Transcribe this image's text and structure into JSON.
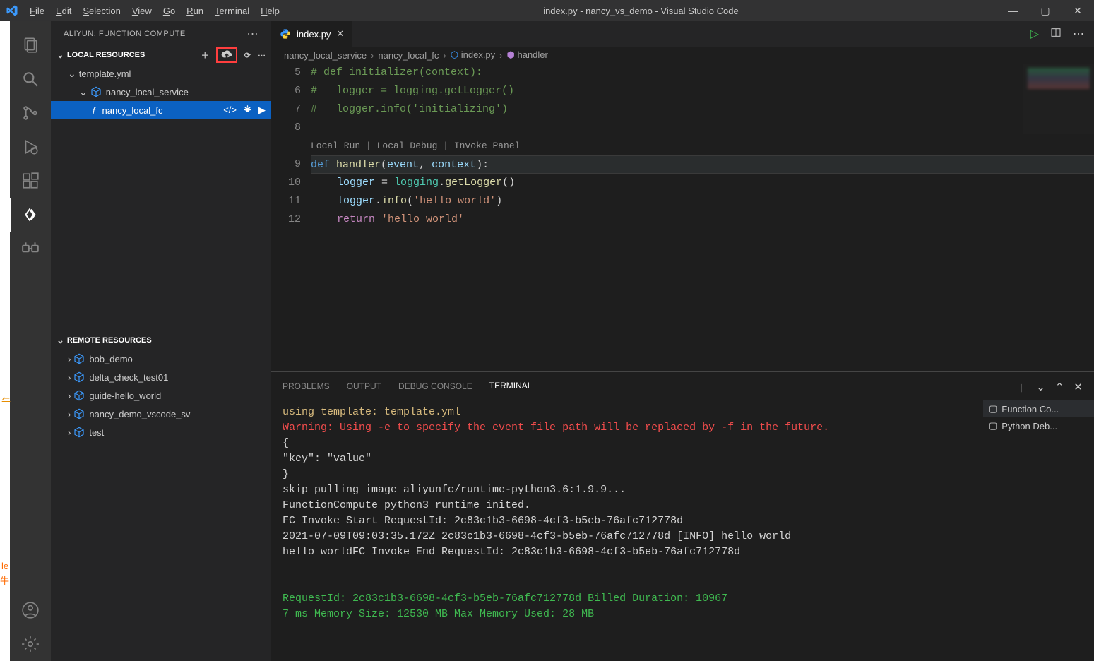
{
  "window": {
    "title": "index.py - nancy_vs_demo - Visual Studio Code",
    "menu": [
      "File",
      "Edit",
      "Selection",
      "View",
      "Go",
      "Run",
      "Terminal",
      "Help"
    ],
    "menu_underline_idx": [
      0,
      0,
      0,
      0,
      0,
      0,
      0,
      0
    ]
  },
  "sidebar": {
    "title": "ALIYUN: FUNCTION COMPUTE",
    "local": {
      "title": "LOCAL RESOURCES",
      "template": "template.yml",
      "service": "nancy_local_service",
      "function": "nancy_local_fc"
    },
    "remote": {
      "title": "REMOTE RESOURCES",
      "items": [
        "bob_demo",
        "delta_check_test01",
        "guide-hello_world",
        "nancy_demo_vscode_sv",
        "test"
      ]
    }
  },
  "editor": {
    "tab": {
      "file": "index.py"
    },
    "breadcrumb": [
      "nancy_local_service",
      "nancy_local_fc",
      "index.py",
      "handler"
    ],
    "codelens": "Local Run | Local Debug | Invoke Panel",
    "lines": [
      {
        "n": 5,
        "tokens": [
          [
            "# def initializer(context):",
            "tok-comment"
          ]
        ]
      },
      {
        "n": 6,
        "tokens": [
          [
            "#   logger = logging.getLogger()",
            "tok-comment"
          ]
        ]
      },
      {
        "n": 7,
        "tokens": [
          [
            "#   logger.info('initializing')",
            "tok-comment"
          ]
        ]
      },
      {
        "n": 8,
        "tokens": [
          [
            "",
            "tok-default"
          ]
        ]
      }
    ],
    "lines_after": [
      {
        "n": 9,
        "current": true,
        "tokens": [
          [
            "def ",
            "tok-keyword"
          ],
          [
            "handler",
            "tok-func"
          ],
          [
            "(",
            "tok-default"
          ],
          [
            "event",
            "tok-var"
          ],
          [
            ", ",
            "tok-default"
          ],
          [
            "context",
            "tok-var"
          ],
          [
            "):",
            "tok-default"
          ]
        ]
      },
      {
        "n": 10,
        "indent": true,
        "tokens": [
          [
            "    ",
            "tok-default"
          ],
          [
            "logger",
            "tok-var"
          ],
          [
            " = ",
            "tok-default"
          ],
          [
            "logging",
            "tok-cls"
          ],
          [
            ".",
            "tok-default"
          ],
          [
            "getLogger",
            "tok-func"
          ],
          [
            "()",
            "tok-default"
          ]
        ]
      },
      {
        "n": 11,
        "indent": true,
        "tokens": [
          [
            "    ",
            "tok-default"
          ],
          [
            "logger",
            "tok-var"
          ],
          [
            ".",
            "tok-default"
          ],
          [
            "info",
            "tok-func"
          ],
          [
            "(",
            "tok-default"
          ],
          [
            "'hello world'",
            "tok-str"
          ],
          [
            ")",
            "tok-default"
          ]
        ]
      },
      {
        "n": 12,
        "indent": true,
        "tokens": [
          [
            "    ",
            "tok-default"
          ],
          [
            "return ",
            "tok-purple"
          ],
          [
            "'hello world'",
            "tok-str"
          ]
        ]
      }
    ]
  },
  "panel": {
    "tabs": [
      "PROBLEMS",
      "OUTPUT",
      "DEBUG CONSOLE",
      "TERMINAL"
    ],
    "active_tab": "TERMINAL",
    "side": [
      "Function Co...",
      "Python Deb..."
    ],
    "terminal": [
      {
        "text": "using template: template.yml",
        "cls": "term-yellow"
      },
      {
        "text": "Warning: Using -e to specify the event file path will be replaced by -f in the future.",
        "cls": "term-red"
      },
      {
        "text": "{",
        "cls": "term-default"
      },
      {
        "text": "  \"key\": \"value\"",
        "cls": "term-default"
      },
      {
        "text": "}",
        "cls": "term-default"
      },
      {
        "text": "skip pulling image aliyunfc/runtime-python3.6:1.9.9...",
        "cls": "term-default"
      },
      {
        "text": "FunctionCompute python3 runtime inited.",
        "cls": "term-default"
      },
      {
        "text": "FC Invoke Start RequestId: 2c83c1b3-6698-4cf3-b5eb-76afc712778d",
        "cls": "term-default"
      },
      {
        "text": "2021-07-09T09:03:35.172Z 2c83c1b3-6698-4cf3-b5eb-76afc712778d [INFO] hello world",
        "cls": "term-default"
      },
      {
        "text": "hello worldFC Invoke End RequestId: 2c83c1b3-6698-4cf3-b5eb-76afc712778d",
        "cls": "term-default"
      },
      {
        "text": "",
        "cls": "term-default"
      },
      {
        "text": "",
        "cls": "term-default"
      },
      {
        "text_parts": [
          [
            "RequestId: 2c83c1b3-6698-4cf3-b5eb-76afc712778d          ",
            "term-green"
          ],
          [
            "Billed Duration: 10967",
            "term-green"
          ]
        ]
      },
      {
        "text_parts": [
          [
            "7 ms     Memory Size: 12530 MB   Max Memory Used: 28 MB",
            "term-green"
          ]
        ]
      }
    ]
  }
}
